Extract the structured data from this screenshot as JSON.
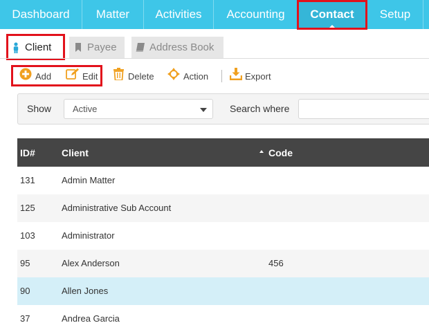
{
  "topnav": {
    "items": [
      {
        "label": "Dashboard"
      },
      {
        "label": "Matter"
      },
      {
        "label": "Activities"
      },
      {
        "label": "Accounting"
      },
      {
        "label": "Contact"
      },
      {
        "label": "Setup"
      }
    ],
    "active": "Contact"
  },
  "tabs": [
    {
      "label": "Client",
      "icon": "person-icon",
      "active": true
    },
    {
      "label": "Payee",
      "icon": "bookmark-icon",
      "active": false
    },
    {
      "label": "Address Book",
      "icon": "book-icon",
      "active": false
    }
  ],
  "toolbar": {
    "add_label": "Add",
    "edit_label": "Edit",
    "delete_label": "Delete",
    "action_label": "Action",
    "export_label": "Export"
  },
  "filter": {
    "show_label": "Show",
    "show_value": "Active",
    "search_label": "Search where",
    "search_value": ""
  },
  "table": {
    "columns": [
      "ID#",
      "Client",
      "Code"
    ],
    "rows": [
      {
        "id": "131",
        "client": "Admin Matter",
        "code": ""
      },
      {
        "id": "125",
        "client": "Administrative Sub Account",
        "code": ""
      },
      {
        "id": "103",
        "client": "Administrator",
        "code": ""
      },
      {
        "id": "95",
        "client": "Alex Anderson",
        "code": "456"
      },
      {
        "id": "90",
        "client": "Allen Jones",
        "code": ""
      },
      {
        "id": "37",
        "client": "Andrea Garcia",
        "code": ""
      }
    ],
    "selected_row": "90"
  },
  "colors": {
    "nav_bg": "#3ec6e8",
    "highlight_box": "#e2111b",
    "toolbar_icon": "#f0a020",
    "header_bg": "#454545",
    "selected_row_bg": "#d4eff8"
  }
}
